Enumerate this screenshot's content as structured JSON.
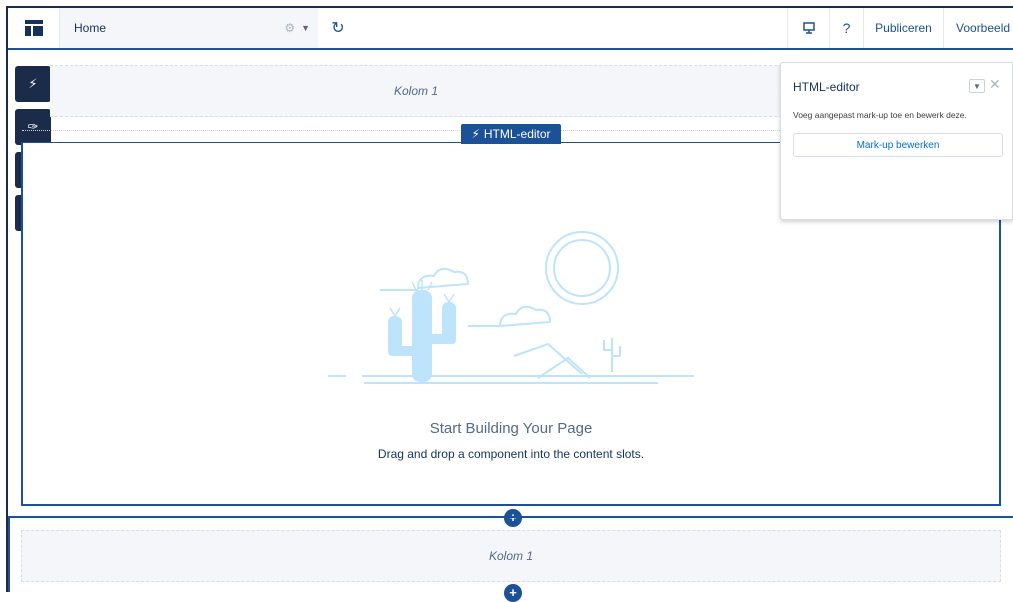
{
  "topbar": {
    "page_name": "Home",
    "publish_label": "Publiceren",
    "preview_label": "Voorbeeld",
    "help_label": "?"
  },
  "canvas": {
    "top_region_label": "Kolom 1",
    "editor_tag_label": "HTML-editor",
    "empty_title": "Start Building Your Page",
    "empty_subtitle": "Drag and drop a component into the content slots.",
    "bottom_region_label": "Kolom 1"
  },
  "panel": {
    "title": "HTML-editor",
    "description": "Voeg aangepast mark-up toe en bewerk deze.",
    "edit_button": "Mark-up bewerken"
  },
  "colors": {
    "accent": "#1b5297",
    "navy": "#1b2b4a",
    "illustration": "#bde4fb"
  },
  "icons": {
    "left_tools": [
      "lightning-icon",
      "brush-icon",
      "list-icon",
      "gear-icon"
    ]
  }
}
